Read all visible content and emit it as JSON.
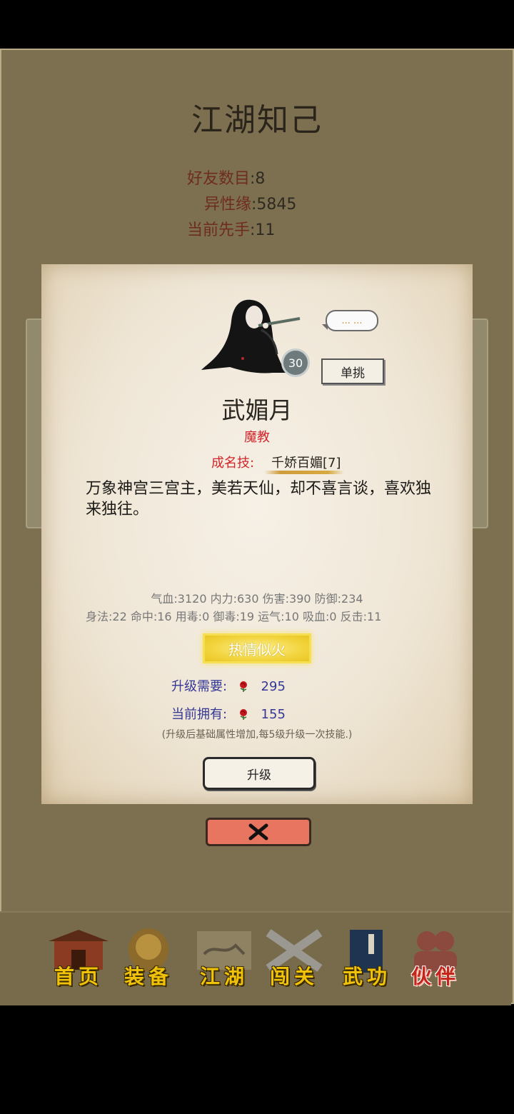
{
  "screen": {
    "title": "江湖知己",
    "stats": [
      {
        "label": "好友数目",
        "value": ":8"
      },
      {
        "label": "异性缘",
        "value": ":5845"
      },
      {
        "label": "当前先手",
        "value": ":11"
      }
    ]
  },
  "dialog": {
    "level": "30",
    "speech": "... ...",
    "duel_label": "单挑",
    "name": "武媚月",
    "faction": "魔教",
    "skill_label": "成名技:",
    "skill_name": "千娇百媚[7]",
    "description": "万象神宫三宫主，美若天仙，却不喜言谈，喜欢独来独往。",
    "stats_line1": "气血:3120  内力:630  伤害:390  防御:234",
    "stats_line2": "身法:22  命中:16  用毒:0  御毒:19  运气:10  吸血:0  反击:11",
    "trait": "热情似火",
    "upgrade_need_label": "升级需要:",
    "upgrade_need_value": "295",
    "owned_label": "当前拥有:",
    "owned_value": "155",
    "note": "(升级后基础属性增加,每5级升级一次技能.)",
    "upgrade_button": "升级"
  },
  "nav": [
    {
      "label": "首页",
      "icon": "gate-house-icon"
    },
    {
      "label": "装备",
      "icon": "armor-icon"
    },
    {
      "label": "江湖",
      "icon": "map-scroll-icon"
    },
    {
      "label": "闯关",
      "icon": "crossed-swords-icon"
    },
    {
      "label": "武功",
      "icon": "book-icon"
    },
    {
      "label": "伙伴",
      "icon": "partners-icon",
      "active": true
    }
  ],
  "colors": {
    "accent_red": "#d0262b",
    "nav_gold": "#f0c20a",
    "close_button": "#e8755f"
  }
}
